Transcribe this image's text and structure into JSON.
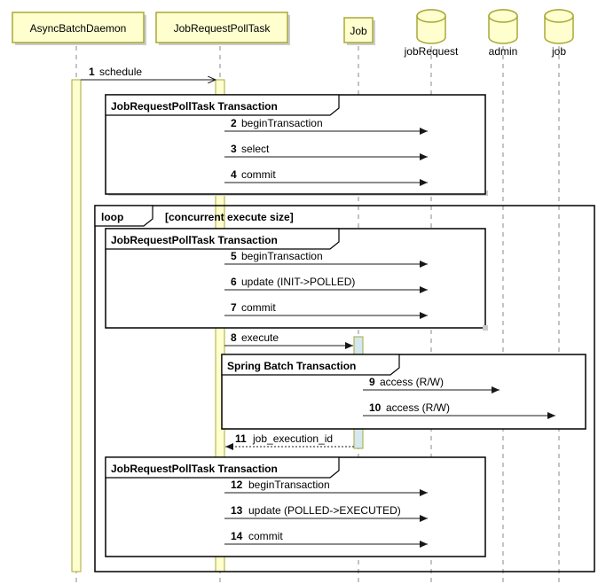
{
  "participants": {
    "p1": "AsyncBatchDaemon",
    "p2": "JobRequestPollTask",
    "p3": "Job",
    "db1": "jobRequest",
    "db2": "admin",
    "db3": "job"
  },
  "frames": {
    "f1": "JobRequestPollTask Transaction",
    "loop": "loop",
    "loopGuard": "[concurrent execute size]",
    "f2": "JobRequestPollTask Transaction",
    "f3": "Spring Batch Transaction",
    "f4": "JobRequestPollTask Transaction"
  },
  "messages": {
    "m1n": "1",
    "m1": "schedule",
    "m2n": "2",
    "m2": "beginTransaction",
    "m3n": "3",
    "m3": "select",
    "m4n": "4",
    "m4": "commit",
    "m5n": "5",
    "m5": "beginTransaction",
    "m6n": "6",
    "m6": "update (INIT->POLLED)",
    "m7n": "7",
    "m7": "commit",
    "m8n": "8",
    "m8": "execute",
    "m9n": "9",
    "m9": "access (R/W)",
    "m10n": "10",
    "m10": "access (R/W)",
    "m11n": "11",
    "m11": "job_execution_id",
    "m12n": "12",
    "m12": "beginTransaction",
    "m13n": "13",
    "m13": "update (POLLED->EXECUTED)",
    "m14n": "14",
    "m14": "commit"
  },
  "chart_data": {
    "type": "table",
    "sequence": [
      {
        "n": 1,
        "from": "AsyncBatchDaemon",
        "to": "JobRequestPollTask",
        "label": "schedule",
        "kind": "sync"
      },
      {
        "frame": "JobRequestPollTask Transaction",
        "messages": [
          {
            "n": 2,
            "from": "JobRequestPollTask",
            "to": "jobRequest",
            "label": "beginTransaction",
            "kind": "sync"
          },
          {
            "n": 3,
            "from": "JobRequestPollTask",
            "to": "jobRequest",
            "label": "select",
            "kind": "sync"
          },
          {
            "n": 4,
            "from": "JobRequestPollTask",
            "to": "jobRequest",
            "label": "commit",
            "kind": "sync"
          }
        ]
      },
      {
        "frame": "loop",
        "guard": "concurrent execute size",
        "messages": [
          {
            "frame": "JobRequestPollTask Transaction",
            "messages": [
              {
                "n": 5,
                "from": "JobRequestPollTask",
                "to": "jobRequest",
                "label": "beginTransaction",
                "kind": "sync"
              },
              {
                "n": 6,
                "from": "JobRequestPollTask",
                "to": "jobRequest",
                "label": "update (INIT->POLLED)",
                "kind": "sync"
              },
              {
                "n": 7,
                "from": "JobRequestPollTask",
                "to": "jobRequest",
                "label": "commit",
                "kind": "sync"
              }
            ]
          },
          {
            "n": 8,
            "from": "JobRequestPollTask",
            "to": "Job",
            "label": "execute",
            "kind": "sync"
          },
          {
            "frame": "Spring Batch Transaction",
            "messages": [
              {
                "n": 9,
                "from": "Job",
                "to": "admin",
                "label": "access (R/W)",
                "kind": "sync"
              },
              {
                "n": 10,
                "from": "Job",
                "to": "job",
                "label": "access (R/W)",
                "kind": "sync"
              }
            ]
          },
          {
            "n": 11,
            "from": "Job",
            "to": "JobRequestPollTask",
            "label": "job_execution_id",
            "kind": "return"
          },
          {
            "frame": "JobRequestPollTask Transaction",
            "messages": [
              {
                "n": 12,
                "from": "JobRequestPollTask",
                "to": "jobRequest",
                "label": "beginTransaction",
                "kind": "sync"
              },
              {
                "n": 13,
                "from": "JobRequestPollTask",
                "to": "jobRequest",
                "label": "update (POLLED->EXECUTED)",
                "kind": "sync"
              },
              {
                "n": 14,
                "from": "JobRequestPollTask",
                "to": "jobRequest",
                "label": "commit",
                "kind": "sync"
              }
            ]
          }
        ]
      }
    ]
  }
}
